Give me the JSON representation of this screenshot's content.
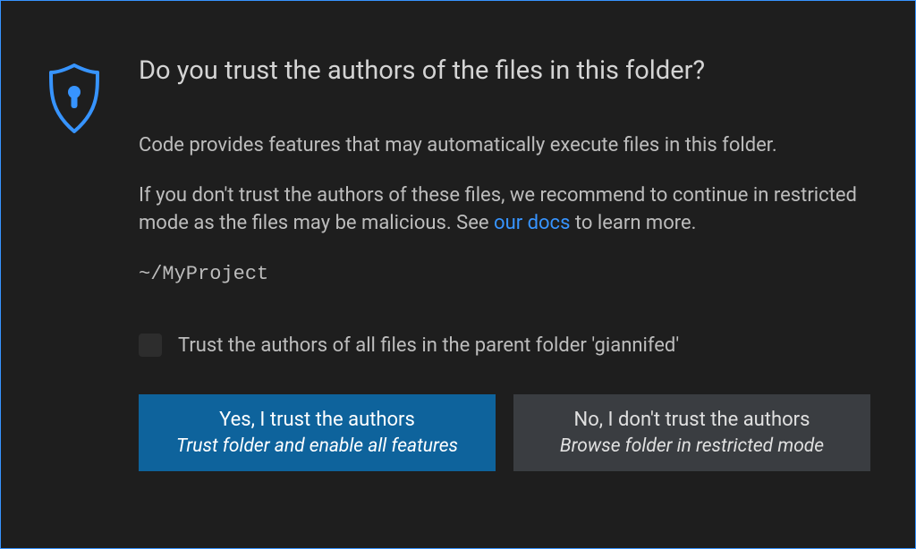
{
  "title": "Do you trust the authors of the files in this folder?",
  "body": {
    "p1": "Code provides features that may automatically execute files in this folder.",
    "p2_pre": "If you don't trust the authors of these files, we recommend to continue in restricted mode as the files may be malicious. See ",
    "p2_link": "our docs",
    "p2_post": " to learn more.",
    "path": "~/MyProject"
  },
  "checkbox": {
    "label": "Trust the authors of all files in the parent folder 'giannifed'",
    "checked": false
  },
  "buttons": {
    "trust": {
      "main": "Yes, I trust the authors",
      "sub": "Trust folder and enable all features"
    },
    "dont_trust": {
      "main": "No, I don't trust the authors",
      "sub": "Browse folder in restricted mode"
    }
  },
  "colors": {
    "accent": "#3794ff",
    "primary_btn": "#0e639c",
    "secondary_btn": "#3a3d41",
    "background": "#1e1e1e"
  }
}
